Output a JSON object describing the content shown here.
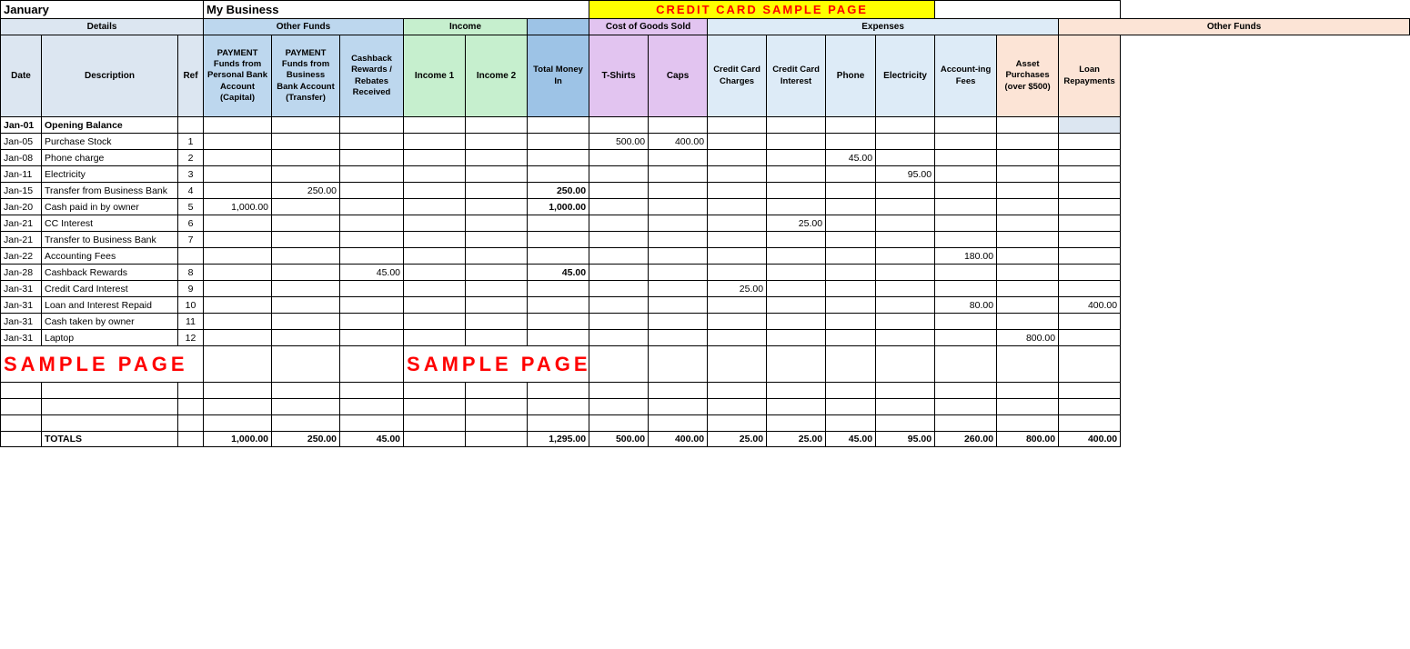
{
  "title": {
    "month": "January",
    "business": "My Business",
    "creditcard": "CREDIT CARD SAMPLE PAGE"
  },
  "sections": {
    "details": "Details",
    "otherFunds": "Other Funds",
    "income": "Income",
    "cogs": "Cost of Goods Sold",
    "expenses": "Expenses",
    "otherFunds2": "Other Funds"
  },
  "columns": {
    "date": "Date",
    "description": "Description",
    "ref": "Ref",
    "payment1": "PAYMENT Funds from Personal Bank Account (Capital)",
    "payment2": "PAYMENT Funds from Business Bank Account (Transfer)",
    "cashback": "Cashback Rewards / Rebates Received",
    "income1": "Income 1",
    "income2": "Income 2",
    "totalMoney": "Total Money In",
    "tshirts": "T-Shirts",
    "caps": "Caps",
    "ccCharges": "Credit Card Charges",
    "ccInterest": "Credit Card Interest",
    "phone": "Phone",
    "electricity": "Electricity",
    "accountingFees": "Account-ing Fees",
    "assetPurchases": "Asset Purchases (over $500)",
    "loanRepayments": "Loan Repayments"
  },
  "rows": [
    {
      "date": "Jan-01",
      "desc": "Opening Balance",
      "ref": "",
      "p1": "",
      "p2": "",
      "cb": "",
      "i1": "",
      "i2": "",
      "tm": "",
      "ts": "",
      "caps": "",
      "ccc": "",
      "cci": "",
      "ph": "",
      "el": "",
      "af": "",
      "ap": "",
      "lr": "",
      "opening": true
    },
    {
      "date": "Jan-05",
      "desc": "Purchase Stock",
      "ref": "1",
      "p1": "",
      "p2": "",
      "cb": "",
      "i1": "",
      "i2": "",
      "tm": "",
      "ts": "500.00",
      "caps": "400.00",
      "ccc": "",
      "cci": "",
      "ph": "",
      "el": "",
      "af": "",
      "ap": "",
      "lr": ""
    },
    {
      "date": "Jan-08",
      "desc": "Phone charge",
      "ref": "2",
      "p1": "",
      "p2": "",
      "cb": "",
      "i1": "",
      "i2": "",
      "tm": "",
      "ts": "",
      "caps": "",
      "ccc": "",
      "cci": "",
      "ph": "45.00",
      "el": "",
      "af": "",
      "ap": "",
      "lr": ""
    },
    {
      "date": "Jan-11",
      "desc": "Electricity",
      "ref": "3",
      "p1": "",
      "p2": "",
      "cb": "",
      "i1": "",
      "i2": "",
      "tm": "",
      "ts": "",
      "caps": "",
      "ccc": "",
      "cci": "",
      "ph": "",
      "el": "95.00",
      "af": "",
      "ap": "",
      "lr": ""
    },
    {
      "date": "Jan-15",
      "desc": "Transfer from Business Bank",
      "ref": "4",
      "p1": "",
      "p2": "250.00",
      "cb": "",
      "i1": "",
      "i2": "",
      "tm": "250.00",
      "ts": "",
      "caps": "",
      "ccc": "",
      "cci": "",
      "ph": "",
      "el": "",
      "af": "",
      "ap": "",
      "lr": ""
    },
    {
      "date": "Jan-20",
      "desc": "Cash paid in by owner",
      "ref": "5",
      "p1": "1,000.00",
      "p2": "",
      "cb": "",
      "i1": "",
      "i2": "",
      "tm": "1,000.00",
      "ts": "",
      "caps": "",
      "ccc": "",
      "cci": "",
      "ph": "",
      "el": "",
      "af": "",
      "ap": "",
      "lr": ""
    },
    {
      "date": "Jan-21",
      "desc": "CC Interest",
      "ref": "6",
      "p1": "",
      "p2": "",
      "cb": "",
      "i1": "",
      "i2": "",
      "tm": "",
      "ts": "",
      "caps": "",
      "ccc": "",
      "cci": "25.00",
      "ph": "",
      "el": "",
      "af": "",
      "ap": "",
      "lr": ""
    },
    {
      "date": "Jan-21",
      "desc": "Transfer to Business Bank",
      "ref": "7",
      "p1": "",
      "p2": "",
      "cb": "",
      "i1": "",
      "i2": "",
      "tm": "",
      "ts": "",
      "caps": "",
      "ccc": "",
      "cci": "",
      "ph": "",
      "el": "",
      "af": "",
      "ap": "",
      "lr": ""
    },
    {
      "date": "Jan-22",
      "desc": "Accounting Fees",
      "ref": "",
      "p1": "",
      "p2": "",
      "cb": "",
      "i1": "",
      "i2": "",
      "tm": "",
      "ts": "",
      "caps": "",
      "ccc": "",
      "cci": "",
      "ph": "",
      "el": "",
      "af": "180.00",
      "ap": "",
      "lr": ""
    },
    {
      "date": "Jan-28",
      "desc": "Cashback Rewards",
      "ref": "8",
      "p1": "",
      "p2": "",
      "cb": "45.00",
      "i1": "",
      "i2": "",
      "tm": "45.00",
      "ts": "",
      "caps": "",
      "ccc": "",
      "cci": "",
      "ph": "",
      "el": "",
      "af": "",
      "ap": "",
      "lr": ""
    },
    {
      "date": "Jan-31",
      "desc": "Credit Card Interest",
      "ref": "9",
      "p1": "",
      "p2": "",
      "cb": "",
      "i1": "",
      "i2": "",
      "tm": "",
      "ts": "",
      "caps": "",
      "ccc": "25.00",
      "cci": "",
      "ph": "",
      "el": "",
      "af": "",
      "ap": "",
      "lr": ""
    },
    {
      "date": "Jan-31",
      "desc": "Loan and Interest Repaid",
      "ref": "10",
      "p1": "",
      "p2": "",
      "cb": "",
      "i1": "",
      "i2": "",
      "tm": "",
      "ts": "",
      "caps": "",
      "ccc": "",
      "cci": "",
      "ph": "",
      "el": "",
      "af": "80.00",
      "ap": "",
      "lr": "400.00"
    },
    {
      "date": "Jan-31",
      "desc": "Cash taken by owner",
      "ref": "11",
      "p1": "",
      "p2": "",
      "cb": "",
      "i1": "",
      "i2": "",
      "tm": "",
      "ts": "",
      "caps": "",
      "ccc": "",
      "cci": "",
      "ph": "",
      "el": "",
      "af": "",
      "ap": "",
      "lr": ""
    },
    {
      "date": "Jan-31",
      "desc": "Laptop",
      "ref": "12",
      "p1": "",
      "p2": "",
      "cb": "",
      "i1": "",
      "i2": "",
      "tm": "",
      "ts": "",
      "caps": "",
      "ccc": "",
      "cci": "",
      "ph": "",
      "el": "",
      "af": "",
      "ap": "800.00",
      "lr": ""
    },
    {
      "date": "",
      "desc": "",
      "ref": "",
      "p1": "",
      "p2": "",
      "cb": "",
      "i1": "",
      "i2": "",
      "tm": "",
      "ts": "",
      "caps": "",
      "ccc": "",
      "cci": "",
      "ph": "",
      "el": "",
      "af": "",
      "ap": "",
      "lr": "",
      "sample": true
    },
    {
      "date": "",
      "desc": "",
      "ref": "",
      "p1": "",
      "p2": "",
      "cb": "",
      "i1": "",
      "i2": "",
      "tm": "",
      "ts": "",
      "caps": "",
      "ccc": "",
      "cci": "",
      "ph": "",
      "el": "",
      "af": "",
      "ap": "",
      "lr": ""
    },
    {
      "date": "",
      "desc": "",
      "ref": "",
      "p1": "",
      "p2": "",
      "cb": "",
      "i1": "",
      "i2": "",
      "tm": "",
      "ts": "",
      "caps": "",
      "ccc": "",
      "cci": "",
      "ph": "",
      "el": "",
      "af": "",
      "ap": "",
      "lr": ""
    },
    {
      "date": "",
      "desc": "",
      "ref": "",
      "p1": "",
      "p2": "",
      "cb": "",
      "i1": "",
      "i2": "",
      "tm": "",
      "ts": "",
      "caps": "",
      "ccc": "",
      "cci": "",
      "ph": "",
      "el": "",
      "af": "",
      "ap": "",
      "lr": ""
    }
  ],
  "totals": {
    "label": "TOTALS",
    "p1": "1,000.00",
    "p2": "250.00",
    "cb": "45.00",
    "i1": "",
    "i2": "",
    "tm": "1,295.00",
    "ts": "500.00",
    "caps": "400.00",
    "ccc": "25.00",
    "cci": "25.00",
    "ph": "45.00",
    "el": "95.00",
    "af": "260.00",
    "ap": "800.00",
    "lr": "400.00"
  },
  "sampleText": "SAMPLE PAGE"
}
